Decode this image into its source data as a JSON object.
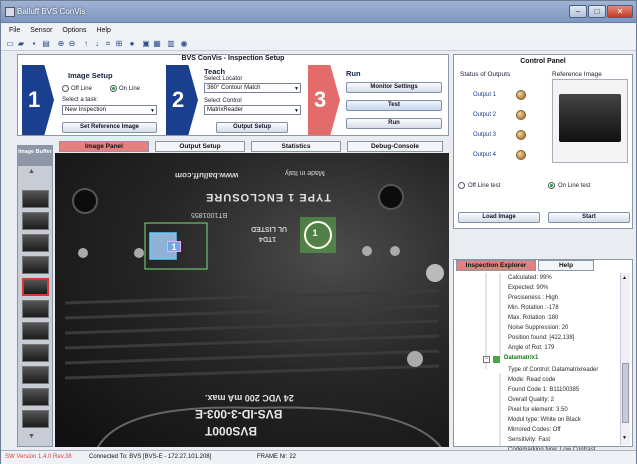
{
  "window": {
    "title": "Balluff BVS ConVis"
  },
  "menu": [
    "File",
    "Sensor",
    "Options",
    "Help"
  ],
  "setup": {
    "header": "BVS ConVis - Inspection Setup",
    "step1": {
      "num": "1",
      "title": "Image Setup",
      "off_line": "Off Line",
      "on_line": "On Line",
      "select_task_label": "Select a task:",
      "task_value": "New Inspection",
      "ref_button": "Set Reference Image"
    },
    "step2": {
      "num": "2",
      "title": "Teach",
      "locator_label": "Select Locator",
      "locator_value": "360° Contour Match",
      "control_label": "Select Control",
      "control_value": "MatrixReader",
      "output_button": "Output Setup"
    },
    "step3": {
      "num": "3",
      "title": "Run",
      "monitor_button": "Monitor Settings",
      "test_button": "Test",
      "run_button": "Run"
    }
  },
  "tabs": [
    "Image Panel",
    "Output Setup",
    "Statistics",
    "Debug-Console"
  ],
  "image_buffer": {
    "title": "Image Buffer"
  },
  "camera": {
    "text_www1": "www.balluff.com",
    "text_made": "Made in Italy",
    "text_enclosure": "TYPE 1 ENCLOSURE",
    "text_code": "BT1001855",
    "text_ul": "UL LISTED",
    "text_ul2": "1TD4",
    "marker1": "1",
    "marker2": "1",
    "text_vdc": "24 VDC 200 mA max.",
    "text_model": "BVS-ID-3-003-E",
    "text_part": "BVS000T"
  },
  "control_panel": {
    "title": "Control Panel",
    "status_title": "Status of Outputs",
    "ref_title": "Reference Image",
    "outputs": [
      "Output 1",
      "Output 2",
      "Output 3",
      "Output 4"
    ],
    "off_line_test": "Off Line test",
    "on_line_test": "On Line test",
    "load_button": "Load Image",
    "start_button": "Start"
  },
  "explorer": {
    "tabs": [
      "Inspection Explorer",
      "Help"
    ],
    "rows": [
      "Calculated: 99%",
      "Expected: 90%",
      "Preciseness : High",
      "Min. Rotation :-178",
      "Max. Rotation :180",
      "Noise Suppression: 20",
      "Position found: [422,138]",
      "Angle of Rot: 179",
      "Datamatrix1",
      "Type of Control: Datamatrixreader",
      "Mode: Read code",
      "Found Code 1: B11100385",
      "Overall Quality: 2",
      "Pixel for element: 3.50",
      "Modul type: White on Black",
      "Mirrored Codes: Off",
      "Sensitivity: Fast",
      "Codemarking type: Low Contrast"
    ]
  },
  "status": {
    "version": "SW Version 1.4.0 Rev.38",
    "connected": "Connected To: BVS [BVS-E - 172.27.101.208]",
    "frame": "FRAME Nr: 22"
  },
  "colors": {
    "step_blue": "#1a3f8f",
    "step_red": "#e36b6b",
    "active_tab": "#e77f7f",
    "tree_node": "#1a7a1a"
  }
}
